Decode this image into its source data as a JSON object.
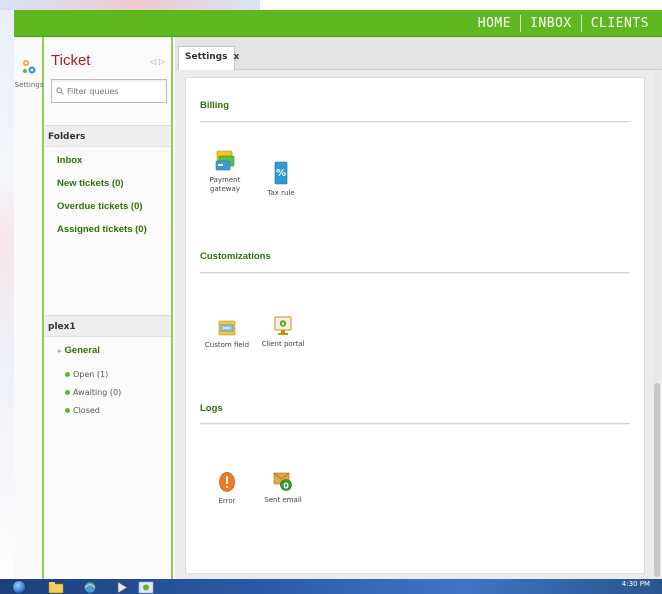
{
  "topnav": {
    "home": "HOME",
    "inbox": "INBOX",
    "clients": "CLIENTS"
  },
  "sidebar": {
    "settings_label": "Settings"
  },
  "ticket_panel": {
    "title": "Ticket",
    "filter_placeholder": "Filter queues",
    "folders_heading": "Folders",
    "folders": [
      "Inbox",
      "New tickets (0)",
      "Overdue tickets (0)",
      "Assigned tickets (0)"
    ],
    "queue_heading": "plex1",
    "queue_group": "General",
    "queues": [
      "Open (1)",
      "Awaiting (0)",
      "Closed"
    ]
  },
  "main": {
    "tab_label": "Settings",
    "tab_close": "x",
    "sections": {
      "billing": {
        "title": "Billing",
        "payment_gateway": "Payment gateway",
        "tax_rule": "Tax rule"
      },
      "customizations": {
        "title": "Customizations",
        "custom_field": "Custom field",
        "client_portal": "Client portal"
      },
      "logs": {
        "title": "Logs",
        "error": "Error",
        "sent_email": "Sent email"
      }
    }
  },
  "taskbar": {
    "clock": "4:30 PM"
  },
  "colors": {
    "topbar": "#5fb81f",
    "accent_green": "#2f6f0e",
    "title_red": "#a81d1d"
  },
  "icons": [
    "settings-icon",
    "search-icon",
    "payment-gateway-icon",
    "tax-rule-icon",
    "custom-field-icon",
    "client-portal-icon",
    "error-icon",
    "sent-email-icon",
    "close-icon"
  ]
}
